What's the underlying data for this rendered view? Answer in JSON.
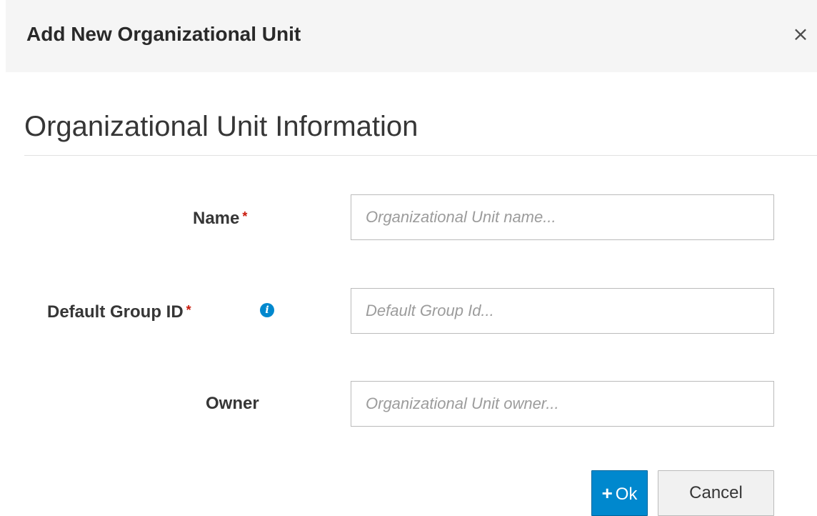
{
  "dialog": {
    "title": "Add New Organizational Unit",
    "close_label": "×"
  },
  "section": {
    "title": "Organizational Unit Information"
  },
  "fields": {
    "name": {
      "label": "Name",
      "required_marker": "*",
      "value": "",
      "placeholder": "Organizational Unit name..."
    },
    "default_group_id": {
      "label": "Default Group ID",
      "required_marker": "*",
      "info_icon": "info-circle-icon",
      "info_glyph": "i",
      "value": "",
      "placeholder": "Default Group Id..."
    },
    "owner": {
      "label": "Owner",
      "value": "",
      "placeholder": "Organizational Unit owner..."
    }
  },
  "actions": {
    "ok_icon": "+",
    "ok_label": "Ok",
    "cancel_label": "Cancel"
  },
  "colors": {
    "primary": "#0088ce",
    "required": "#c9190b",
    "header_bg": "#f5f5f5"
  }
}
